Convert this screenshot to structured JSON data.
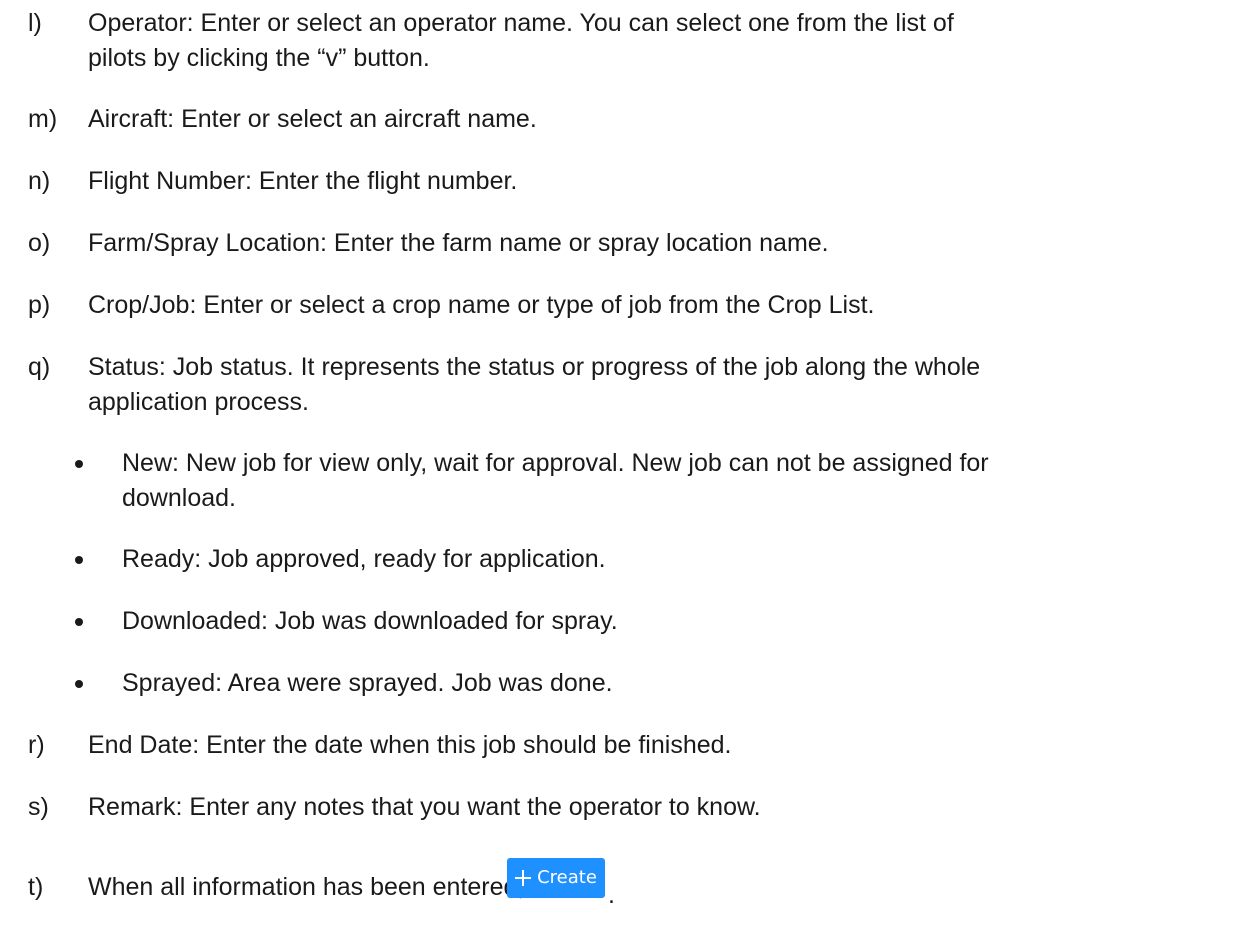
{
  "items": [
    {
      "marker": "l)",
      "lines": [
        "Operator:  Enter or select an operator name. You can select one from the list of",
        "pilots by clicking the “v” button."
      ]
    },
    {
      "marker": "m)",
      "lines": [
        "Aircraft:  Enter or select an aircraft name."
      ]
    },
    {
      "marker": "n)",
      "lines": [
        "Flight Number:  Enter the flight number."
      ]
    },
    {
      "marker": "o)",
      "lines": [
        "Farm/Spray Location:  Enter the farm name or spray location name."
      ]
    },
    {
      "marker": "p)",
      "lines": [
        "Crop/Job:  Enter or select a crop name or type of job from the Crop List."
      ]
    },
    {
      "marker": "q)",
      "lines": [
        "Status:  Job status. It represents the status or progress of the job along the whole",
        "application process."
      ]
    },
    {
      "marker": "r)",
      "lines": [
        "End Date:  Enter the date when this job should be finished."
      ]
    },
    {
      "marker": "s)",
      "lines": [
        "Remark:  Enter any notes that you want the operator to know."
      ]
    },
    {
      "marker": "t)",
      "lines": [
        "When all information has been entered, click"
      ]
    }
  ],
  "status_bullets": [
    {
      "lines": [
        "New:  New job for view only, wait for approval. New job can not be assigned for",
        "download."
      ]
    },
    {
      "lines": [
        "Ready:  Job approved, ready for application."
      ]
    },
    {
      "lines": [
        "Downloaded:  Job was downloaded for spray."
      ]
    },
    {
      "lines": [
        "Sprayed:  Area were sprayed. Job was done."
      ]
    }
  ],
  "create_button": {
    "label": "Create",
    "icon": "plus-icon",
    "color": "#1e90ff"
  },
  "trailing_period": "."
}
